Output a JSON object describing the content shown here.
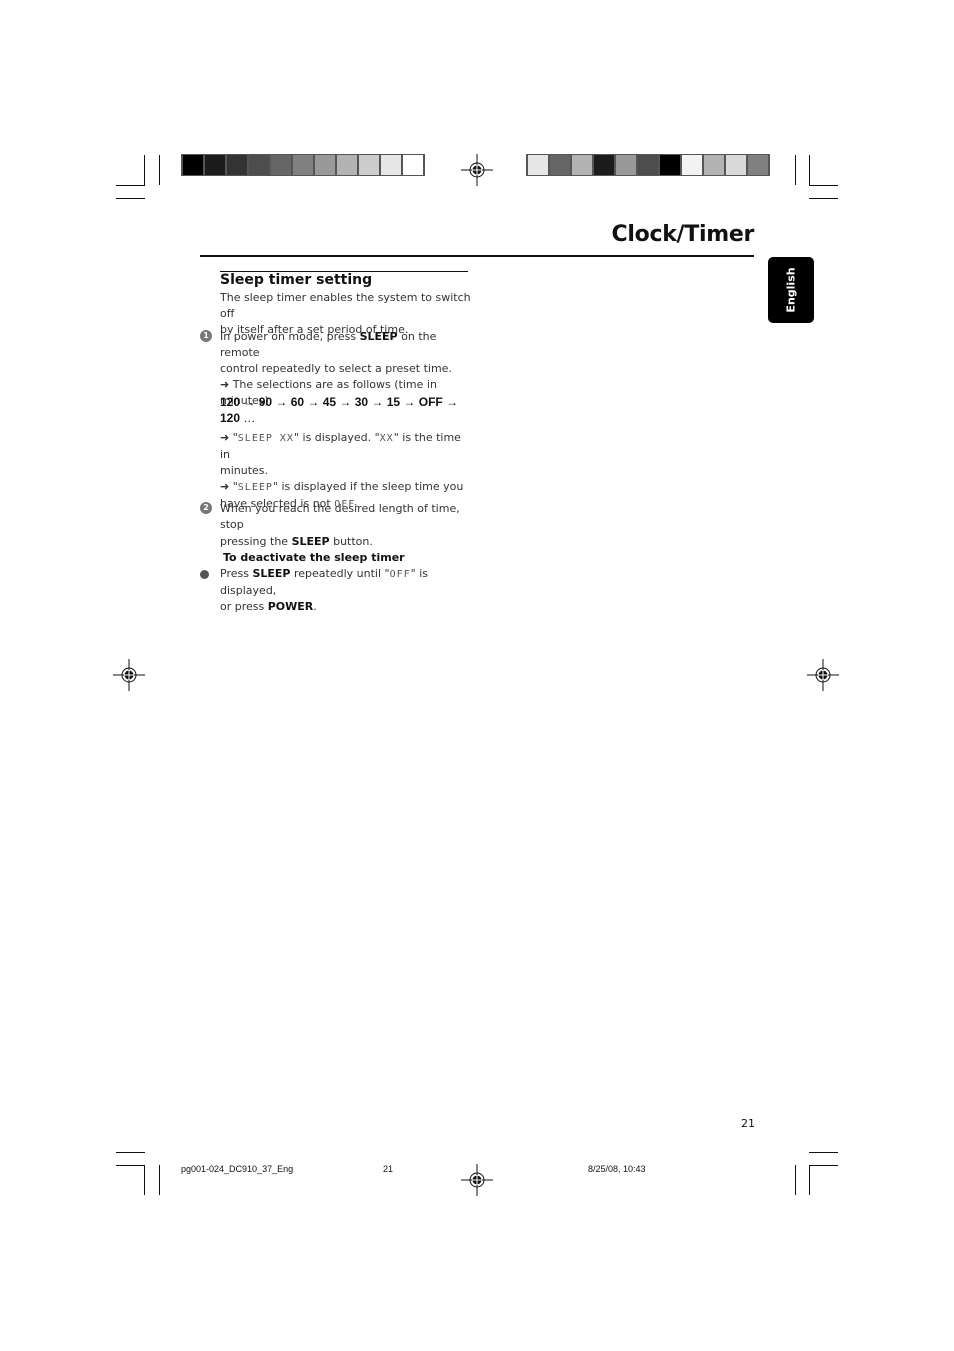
{
  "header": {
    "colorbar_left": [
      "#000000",
      "#1c1c1c",
      "#333333",
      "#4d4d4d",
      "#666666",
      "#808080",
      "#999999",
      "#b3b3b3",
      "#cccccc",
      "#e6e6e6",
      "#ffffff"
    ],
    "colorbar_right": [
      "#e6e6e6",
      "#666666",
      "#b3b3b3",
      "#1c1c1c",
      "#999999",
      "#4d4d4d",
      "#000000",
      "#f2f2f2",
      "#b3b3b3",
      "#d9d9d9",
      "#808080"
    ]
  },
  "page": {
    "title": "Clock/Timer",
    "language_tab": "English",
    "page_number": "21"
  },
  "section": {
    "title": "Sleep timer setting",
    "intro_line1": "The sleep timer enables the system to switch off",
    "intro_line2": "by itself after a set period of time.",
    "step1": {
      "icon": "1",
      "pre": "In power on mode, press ",
      "key": "SLEEP",
      "post": " on the remote",
      "line2": "control repeatedly to select a preset time.",
      "arrow": "➜",
      "line3": " The selections are as follows (time in",
      "line4": "minutes):",
      "sequence_line1": "120 → 90 → 60 → 45 → 30 → 15 → OFF  →",
      "sequence_line2_bold": "120",
      "sequence_line2_rest": " …",
      "note1_arrow": "➜",
      "note1_q1": " \"",
      "note1_lcd": "SLEEP  XX",
      "note1_mid": "\" is displayed. \"",
      "note1_lcd2": "XX",
      "note1_end": "\" is the time in",
      "note1_line2": "minutes.",
      "note2_arrow": "➜",
      "note2_q1": " \"",
      "note2_lcd": "SLEEP",
      "note2_end": "\" is displayed if the sleep time you",
      "note2_line2_pre": "have selected is not ",
      "note2_lcd2": "OFF",
      "note2_line2_post": "."
    },
    "step2": {
      "icon": "2",
      "line1": "When you reach the desired length of time, stop",
      "pre": "pressing the ",
      "key": "SLEEP",
      "post": " button."
    },
    "deactivate": {
      "heading": "To deactivate the sleep timer",
      "pre": "Press ",
      "key1": "SLEEP",
      "mid": " repeatedly until \"",
      "lcd": "OFF",
      "mid2": "\" is displayed,",
      "line2_pre": "or press ",
      "key2": "POWER",
      "line2_post": "."
    }
  },
  "footer": {
    "file": "pg001-024_DC910_37_Eng",
    "page": "21",
    "datetime": "8/25/08, 10:43"
  }
}
